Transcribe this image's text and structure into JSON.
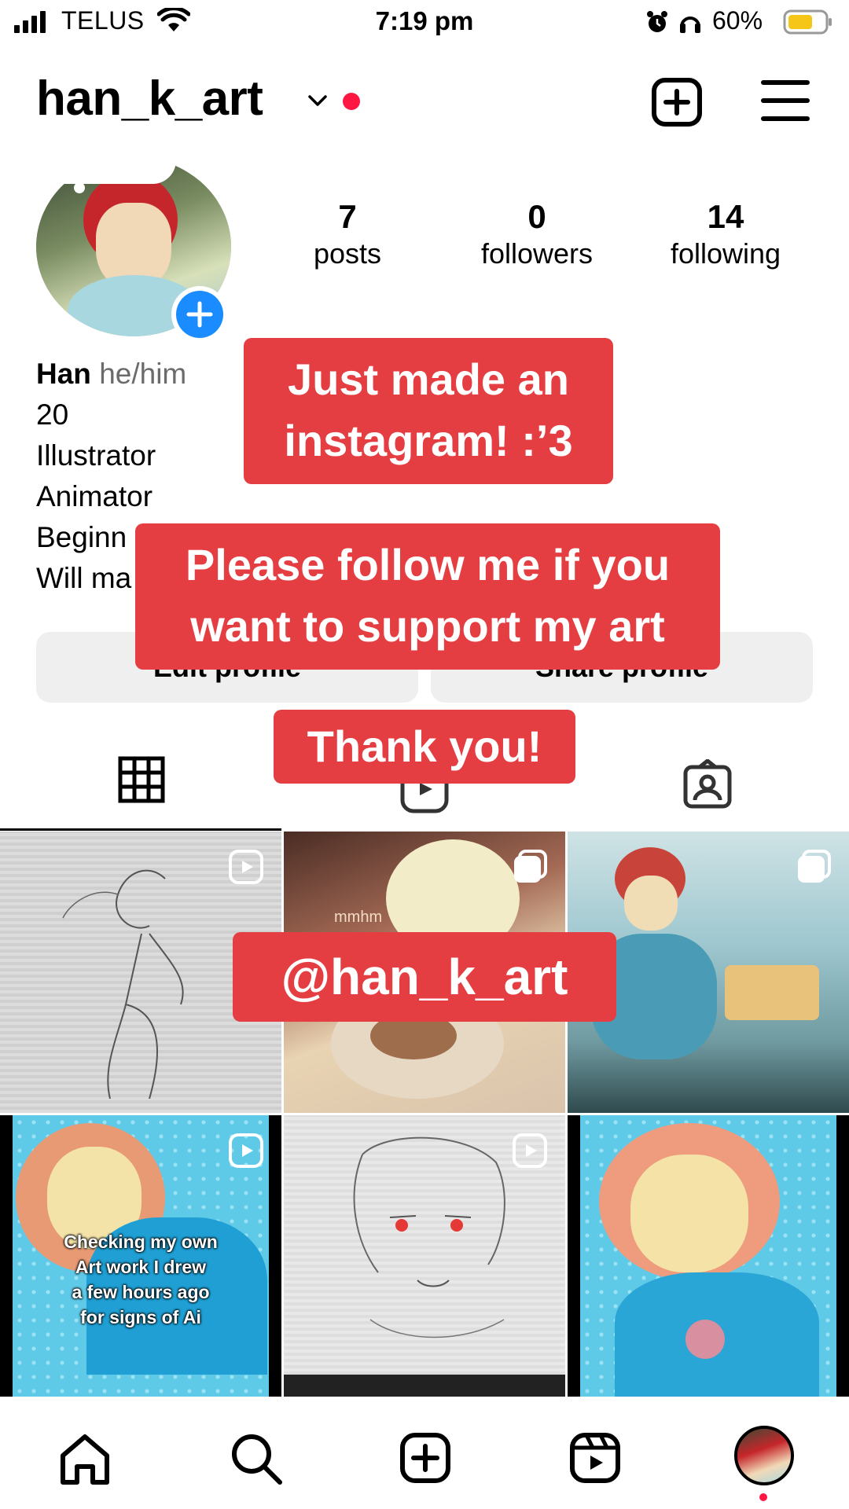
{
  "status_bar": {
    "carrier": "TELUS",
    "time": "7:19 pm",
    "battery_percent": "60%"
  },
  "header": {
    "username": "han_k_art"
  },
  "stats": [
    {
      "value": "7",
      "label": "posts"
    },
    {
      "value": "0",
      "label": "followers"
    },
    {
      "value": "14",
      "label": "following"
    }
  ],
  "bio": {
    "name": "Han",
    "pronouns": "he/him",
    "lines": [
      "20",
      "Illustrator",
      "Animator",
      "Beginn",
      "Will ma"
    ]
  },
  "buttons": {
    "edit_profile": "Edit profile",
    "share_profile": "Share profile"
  },
  "overlays": {
    "text1_line1": "Just made an",
    "text1_line2": "instagram! :’3",
    "text2_line1": "Please follow me if you",
    "text2_line2": "want to support my art",
    "text3": "Thank you!",
    "text4": "@han_k_art"
  },
  "grid_posts": [
    {
      "type": "reel",
      "caption": ""
    },
    {
      "type": "carousel",
      "caption": "mmhm"
    },
    {
      "type": "carousel",
      "caption": ""
    },
    {
      "type": "reel",
      "caption_lines": [
        "Checking my own",
        "Art work I drew",
        "a few hours ago",
        "for signs of Ai"
      ]
    },
    {
      "type": "reel",
      "caption": ""
    },
    {
      "type": "post",
      "caption": ""
    }
  ],
  "nav": [
    "home-icon",
    "search-icon",
    "create-icon",
    "reels-icon",
    "profile-avatar"
  ],
  "colors": {
    "accent_red": "#e53e42",
    "notification_dot": "#ff1744",
    "add_blue": "#1a8cff",
    "battery_yellow": "#f5c518"
  }
}
